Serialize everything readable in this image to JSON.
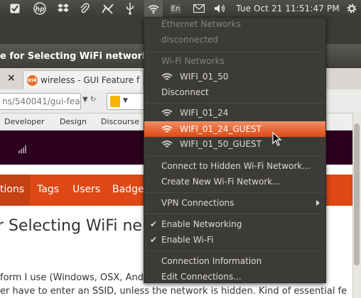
{
  "panel": {
    "clock": "Tue Oct 21 11:51:47 PM",
    "keyboard": "En"
  },
  "browser": {
    "title": "e for Selecting WiFi network -",
    "tab_label": "wireless - GUI Feature f",
    "tab_favicon": "ask",
    "url": "ns/540041/gui-fea",
    "bookmarks": [
      "Developer",
      "Design",
      "Discourse"
    ],
    "nav": [
      "tions",
      "Tags",
      "Users",
      "Badge"
    ],
    "headline": "r Selecting WiFi ne",
    "body_lines": [
      "form I use (Windows, OSX, Andro",
      "er have to enter an SSID, unless the network is hidden. Kind of essential fe"
    ]
  },
  "menu": {
    "ethernet_header": "Ethernet Networks",
    "ethernet_status": "disconnected",
    "wifi_header": "Wi-Fi Networks",
    "connected_network": "WIFI_01_50",
    "disconnect": "Disconnect",
    "networks": [
      "WIFI_01_24",
      "WIFI_01_24_GUEST",
      "WIFI_01_50_GUEST"
    ],
    "hidden_network": "Connect to Hidden Wi-Fi Network...",
    "new_network": "Create New Wi-Fi Network...",
    "vpn": "VPN Connections",
    "enable_networking": "Enable Networking",
    "enable_wifi": "Enable Wi-Fi",
    "connection_info": "Connection Information",
    "edit_connections": "Edit Connections...",
    "check_mark": "✔"
  },
  "colors": {
    "highlight": "#dd4814",
    "menu_bg": "#3c3b37",
    "ubuntu_aubergine": "#2c001e"
  }
}
